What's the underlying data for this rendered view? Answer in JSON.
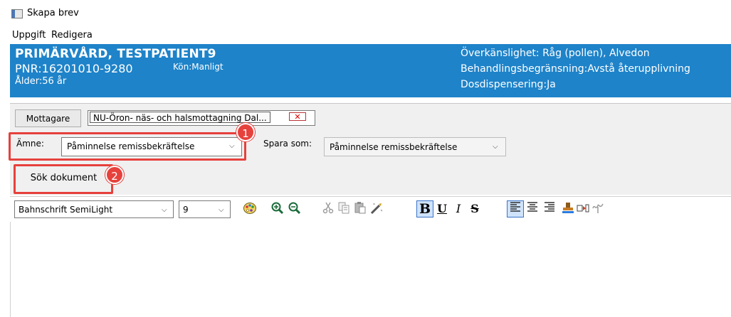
{
  "window": {
    "title": "Skapa brev",
    "icon": "document-window-icon"
  },
  "menu": {
    "items": [
      "Uppgift",
      "Redigera"
    ]
  },
  "patient": {
    "name": "PRIMÄRVÅRD, TESTPATIENT9",
    "pnr": "PNR:16201010-9280",
    "gender": "Kön:Manligt",
    "age": "Ålder:56 år",
    "allergy": "Överkänslighet: Råg (pollen), Alvedon",
    "treatment_limit": "Behandlingsbegränsning:Avstå återupplivning",
    "dose_dispensing": "Dosdispensering:Ja",
    "banner_color": "#1e83c9"
  },
  "form": {
    "recipient_button": "Mottagare",
    "recipient_value": "NU-Öron- näs- och halsmottagning Dal...",
    "recipient_remove": "✕",
    "subject_label": "Ämne:",
    "subject_value": "Påminnelse remissbekräftelse",
    "saveas_label": "Spara som:",
    "saveas_value": "Påminnelse remissbekräftelse",
    "search_button": "Sök dokument"
  },
  "annotations": {
    "badge_1": "1",
    "badge_2": "2",
    "highlight_color": "#e6413d"
  },
  "toolbar": {
    "font_value": "Bahnschrift SemiLight",
    "size_value": "9",
    "chevron": "⌵",
    "bold": "B",
    "underline": "U",
    "italic": "I",
    "strike": "S"
  }
}
